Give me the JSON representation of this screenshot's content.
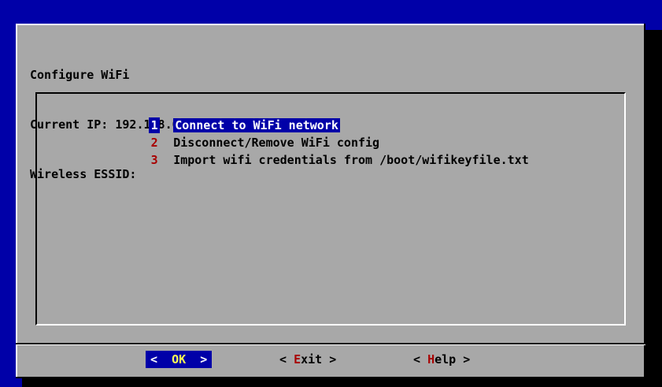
{
  "dialog": {
    "prompt_lines": [
      "Configure WiFi",
      "Current IP: 192.168.0.186",
      "Wireless ESSID:"
    ]
  },
  "menu": {
    "items": [
      {
        "tag": "1",
        "label": "Connect to WiFi network",
        "selected": true
      },
      {
        "tag": "2",
        "label": "Disconnect/Remove WiFi config",
        "selected": false
      },
      {
        "tag": "3",
        "label": "Import wifi credentials from /boot/wifikeyfile.txt",
        "selected": false
      }
    ]
  },
  "buttons": {
    "ok": {
      "left": "<",
      "hot": "OK",
      "rest": "",
      "right": ">"
    },
    "exit": {
      "left": "<",
      "hot": "E",
      "rest": "xit",
      "right": ">"
    },
    "help": {
      "left": "<",
      "hot": "H",
      "rest": "elp",
      "right": ">"
    }
  },
  "colors": {
    "background": "#0000a8",
    "dialog": "#a8a8a8",
    "highlight": "#0000a8",
    "hotkey": "#a80000",
    "selected_hotkey": "#ffff54"
  }
}
